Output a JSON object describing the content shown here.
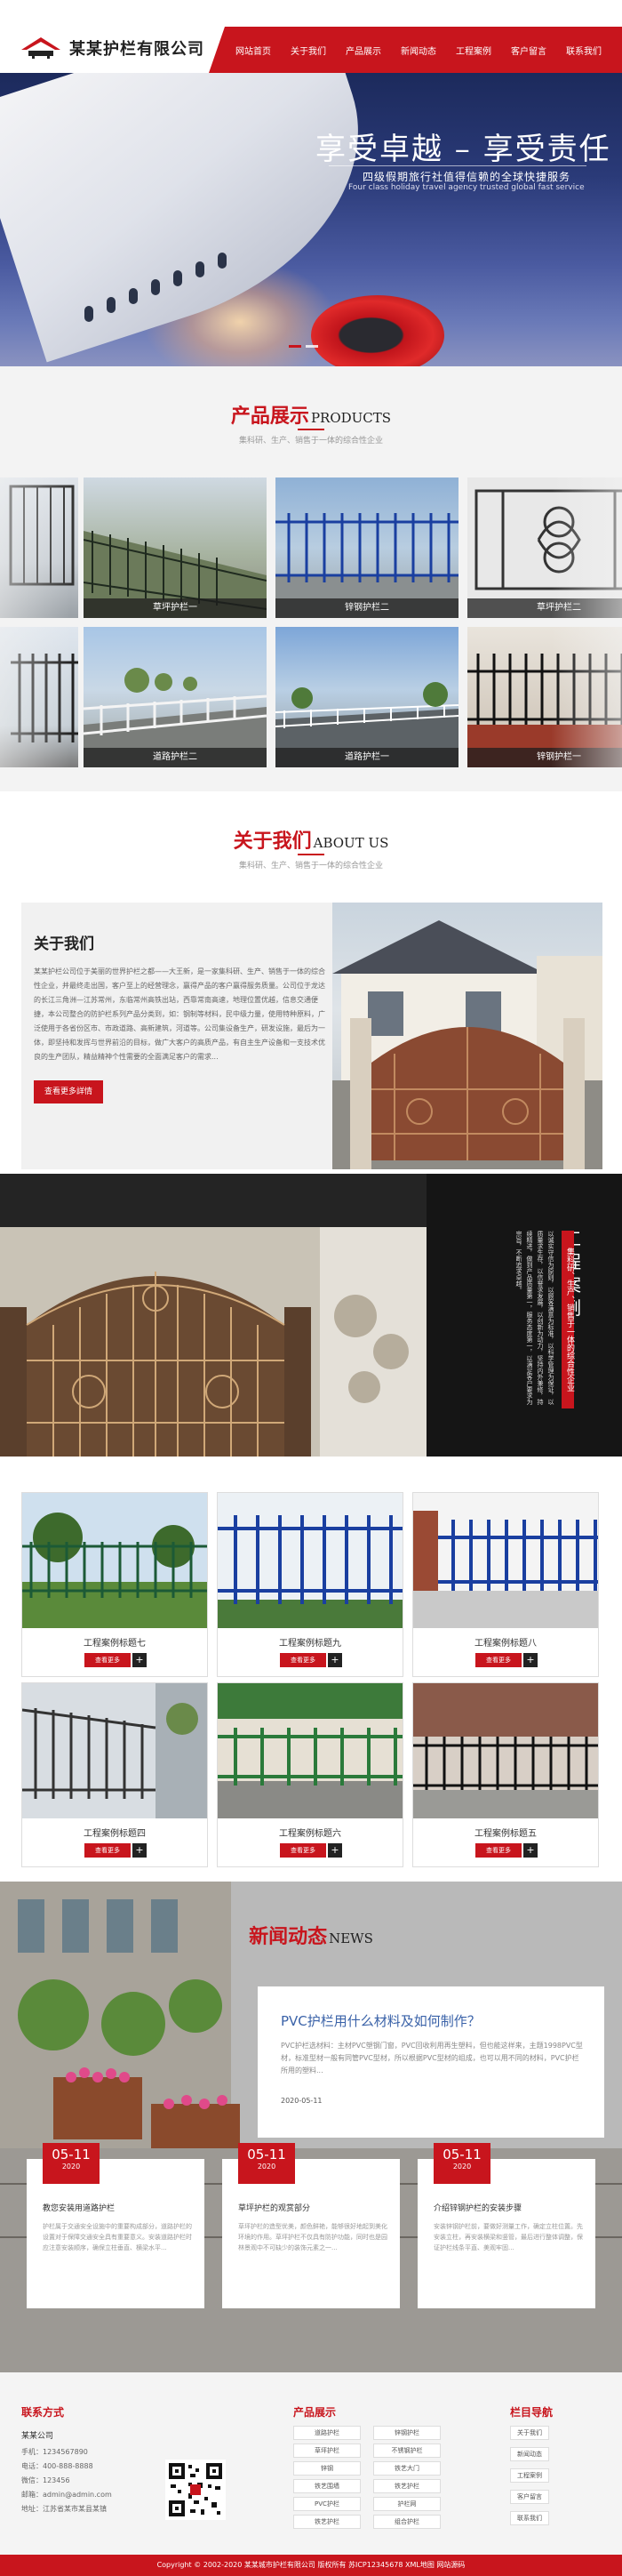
{
  "header": {
    "logo_text": "某某护栏有限公司",
    "nav": [
      "网站首页",
      "关于我们",
      "产品展示",
      "新闻动态",
      "工程案例",
      "客户留言",
      "联系我们"
    ]
  },
  "banner": {
    "title": "享受卓越 – 享受责任",
    "subtitle": "四级假期旅行社值得信赖的全球快捷服务",
    "subtitle_en": "Four class holiday travel agency trusted global fast service"
  },
  "products": {
    "title_cn": "产品展示",
    "title_en": "PRODUCTS",
    "subtitle": "集科研、生产、销售于一体的综合性企业",
    "items": [
      "草坪护栏一",
      "锌钢护栏二",
      "草坪护栏二",
      "道路护栏二",
      "道路护栏一",
      "锌钢护栏一"
    ]
  },
  "about": {
    "title_cn": "关于我们",
    "title_en": "ABOUT US",
    "subtitle": "集科研、生产、销售于一体的综合性企业",
    "heading": "关于我们",
    "text": "某某护栏公司位于美丽的世界护栏之都——大王新，是一家集科研、生产、销售于一体的综合性企业，并最终走出国，客户至上的经营理念，赢得产品的客户赢得服务质量。公司位于龙达的长江三角洲—江苏常州，东临常州高铁出站，西靠常南高速，地理位置优越，信息交通便捷，本公司整合的防护栏系列产品分类到，如：钢制等材料，民中级力量，使用特种原料，广泛使用于各省份区市、市政道路、高新建筑，河道等。公司集设备生产，研发设施，最后为一体，即坚持和发挥与世界前沿的目标，做广大客户的高质产品，有自主生产设备和一支技术优良的生产团队，精益精神个性需要的全面满足客户的需求...",
    "button": "查看更多詳情"
  },
  "cases": {
    "title_char1": "工",
    "title_char2": "程",
    "title_char3": "案",
    "title_char4": "例",
    "slogan": "集科研、生产、销售于一体的综合性企业",
    "desc": "以诚实守信为原则，以顾客满意为标准，以科学管理为保证，以质量求生存，以信誉求发展，以创新为动力，坚持内外兼修，持续精进，做到产品质量第一，服务态度第一，以满足客户要求为宗旨，不断追求卓越。",
    "more": "查看更多",
    "items": [
      "工程案例标题七",
      "工程案例标题九",
      "工程案例标题八",
      "工程案例标题四",
      "工程案例标题六",
      "工程案例标题五"
    ]
  },
  "news": {
    "title_cn": "新闻动态",
    "title_en": "NEWS",
    "featured": {
      "title": "PVC护栏用什么材料及如何制作？",
      "text": "PVC护栏选材料：主材PVC塑钢门窗，PVC回收利用再生塑料，但也能这样来，主题1998PVC型材，标准型材一般有同管PVC型材，所以根据PVC型材的组成，也可以用不同的材料，PVC护栏所用的塑料...",
      "date": "2020-05-11"
    },
    "cards": [
      {
        "day": "05-11",
        "year": "2020",
        "title": "教您安装用道路护栏",
        "text": "护栏属于交通安全设施中的重要构成部分，道路护栏的设置对于保障交通安全具有重要意义。安装道路护栏时应注意安装顺序，确保立柱垂直、横梁水平..."
      },
      {
        "day": "05-11",
        "year": "2020",
        "title": "草坪护栏的观赏部分",
        "text": "草坪护栏的造型优美，颜色鲜艳，能够很好地起到美化环境的作用。草坪护栏不仅具有防护功能，同时也是园林景观中不可缺少的装饰元素之一..."
      },
      {
        "day": "05-11",
        "year": "2020",
        "title": "介绍锌钢护栏的安装步骤",
        "text": "安装锌钢护栏前，要做好测量工作，确定立柱位置。先安装立柱，再安装横梁和竖管，最后进行整体调整，保证护栏线条平直、美观牢固..."
      }
    ]
  },
  "footer": {
    "contact_title": "联系方式",
    "company": "某某公司",
    "lines": [
      "手机：1234567890",
      "电话：400-888-8888",
      "微信：123456",
      "邮箱：admin@admin.com",
      "地址：江苏省某市某县某镇"
    ],
    "products_title": "产品展示",
    "products": [
      "道路护栏",
      "锌钢护栏",
      "草坪护栏",
      "不锈钢护栏",
      "锌钢",
      "铁艺大门",
      "铁艺围墙",
      "铁艺护栏",
      "PVC护栏",
      "护栏网",
      "铁艺护栏",
      "组合护栏"
    ],
    "nav_title": "栏目导航",
    "nav": [
      "关于我们",
      "新闻动态",
      "工程案例",
      "客户留言",
      "联系我们"
    ],
    "copyright": "Copyright © 2002-2020 某某城市护栏有限公司 版权所有  苏ICP12345678  XML地图  网站源码"
  }
}
